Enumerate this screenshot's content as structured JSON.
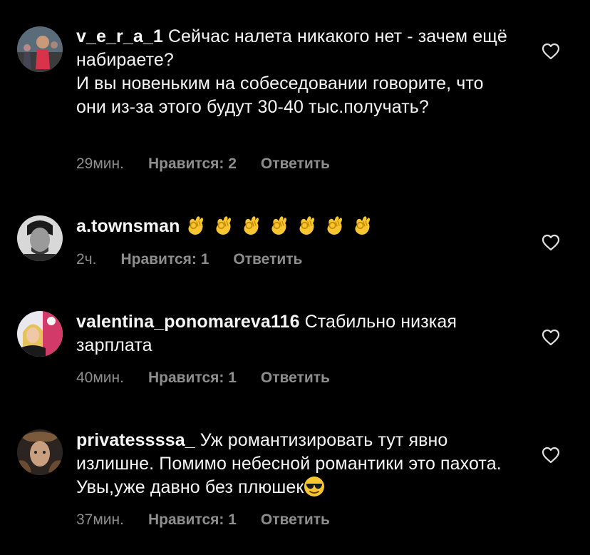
{
  "comments": [
    {
      "username": "v_e_r_a_1",
      "text": "Сейчас налета никакого нет - зачем ещё набираете?",
      "text2": "И вы новеньким на собеседовании говорите, что они из-за этого будут 30-40 тыс.получать?",
      "time": "29мин.",
      "likes": "Нравится: 2",
      "reply": "Ответить",
      "avatar_icon": "runner-woman-photo"
    },
    {
      "username": "a.townsman",
      "text": "",
      "emojis": [
        "ok-hand",
        "ok-hand",
        "ok-hand",
        "ok-hand",
        "ok-hand",
        "ok-hand",
        "ok-hand"
      ],
      "time": "2ч.",
      "likes": "Нравится: 1",
      "reply": "Ответить",
      "avatar_icon": "man-portrait-bw"
    },
    {
      "username": "valentina_ponomareva116",
      "text": "Стабильно низкая зарплата",
      "time": "40мин.",
      "likes": "Нравится: 1",
      "reply": "Ответить",
      "avatar_icon": "blonde-woman-photo"
    },
    {
      "username": "privatessssa_",
      "text": "Уж романтизировать тут явно излишне. Помимо небесной романтики это пахота. Увы,уже давно без плюшек",
      "emoji_end": "sunglasses-face",
      "time": "37мин.",
      "likes": "Нравится: 1",
      "reply": "Ответить",
      "avatar_icon": "ornate-face-art"
    }
  ],
  "icons": {
    "like": "heart-outline-icon"
  },
  "colors": {
    "background": "#000000",
    "text": "#f5f5f5",
    "meta": "#8e8e8e",
    "emoji": "#f7c631"
  }
}
